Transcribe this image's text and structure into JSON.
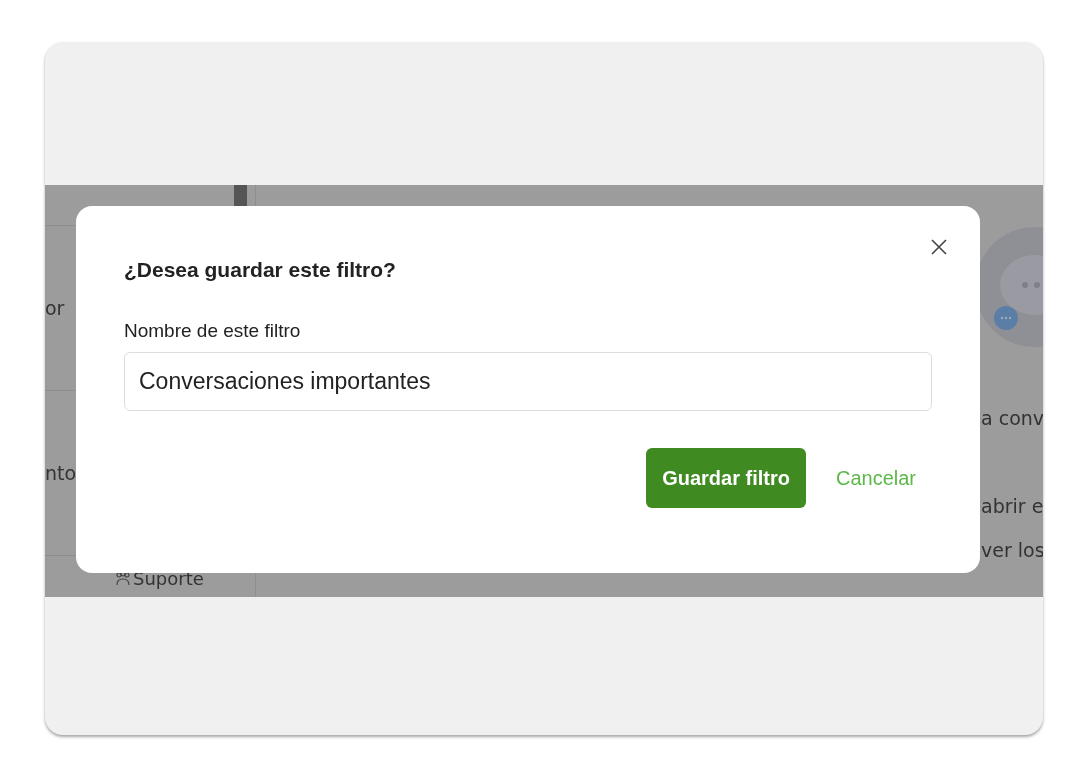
{
  "background_app": {
    "sidebar_items": [
      {
        "label": "or"
      },
      {
        "label": "nto"
      }
    ],
    "support_link": "Suporte",
    "main_texts": [
      "a conv",
      "abrir e",
      "ver los"
    ]
  },
  "dialog": {
    "title": "¿Desea guardar este filtro?",
    "field_label": "Nombre de este filtro",
    "field_value": "Conversaciones importantes",
    "buttons": [
      {
        "label": "Guardar filtro",
        "kind": "primary"
      },
      {
        "label": "Cancelar",
        "kind": "link"
      }
    ]
  }
}
